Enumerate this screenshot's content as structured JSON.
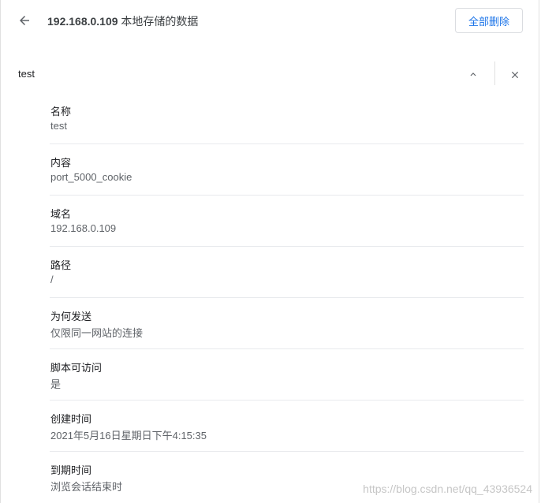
{
  "header": {
    "host": "192.168.0.109",
    "title_suffix": " 本地存储的数据",
    "delete_all_label": "全部删除",
    "back_icon": "arrow-back-icon"
  },
  "cookie": {
    "name": "test",
    "collapse_icon": "chevron-up-icon",
    "close_icon": "close-icon"
  },
  "details": [
    {
      "label": "名称",
      "value": "test"
    },
    {
      "label": "内容",
      "value": "port_5000_cookie"
    },
    {
      "label": "域名",
      "value": "192.168.0.109"
    },
    {
      "label": "路径",
      "value": "/"
    },
    {
      "label": "为何发送",
      "value": "仅限同一网站的连接"
    },
    {
      "label": "脚本可访问",
      "value": "是"
    },
    {
      "label": "创建时间",
      "value": "2021年5月16日星期日下午4:15:35"
    },
    {
      "label": "到期时间",
      "value": "浏览会话结束时"
    }
  ],
  "watermark": "https://blog.csdn.net/qq_43936524",
  "colors": {
    "accent": "#1a73e8",
    "text": "#202124",
    "secondary_text": "#5f6368",
    "divider": "#e8eaed"
  }
}
